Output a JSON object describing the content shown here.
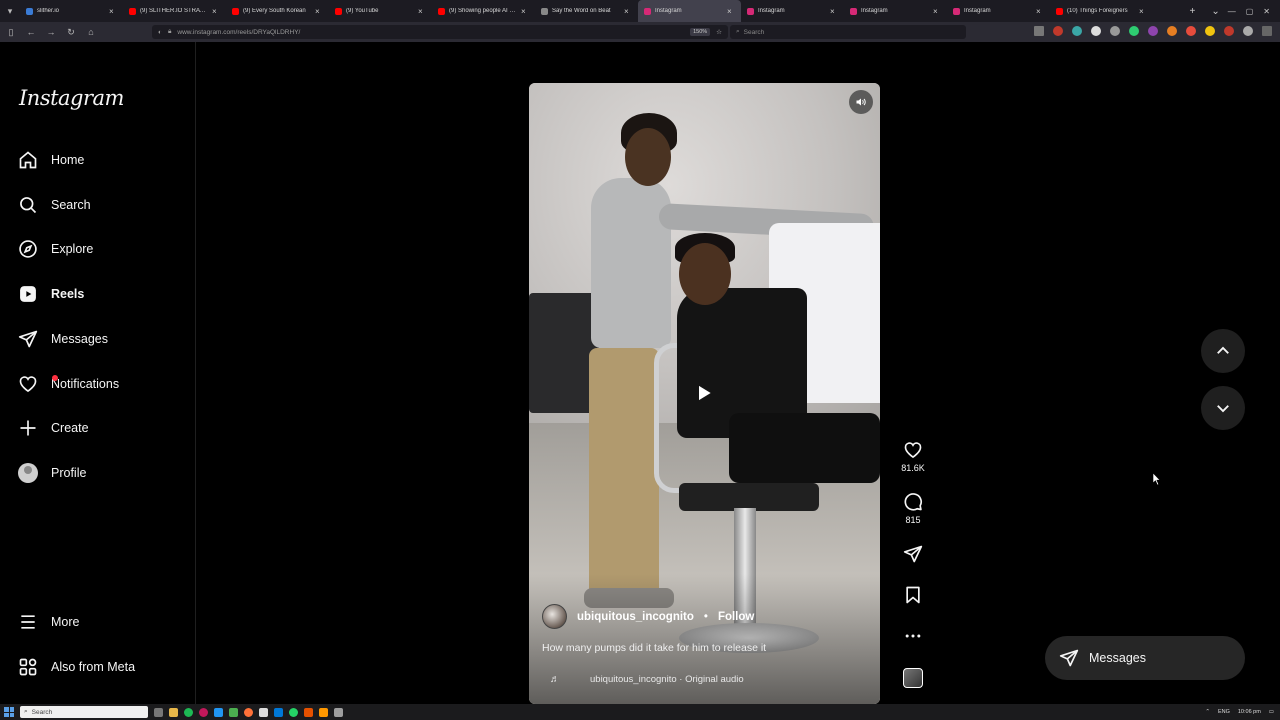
{
  "browser": {
    "tabs": [
      {
        "label": "slither.io",
        "color": "#3a7bd5"
      },
      {
        "label": "(9) SLITHER.IO STRATEGIES",
        "color": "#ff0000"
      },
      {
        "label": "(9) Every South Korean",
        "color": "#ff0000"
      },
      {
        "label": "(9) YouTube",
        "color": "#ff0000"
      },
      {
        "label": "(9) Showing people AI edits",
        "color": "#ff0000"
      },
      {
        "label": "Say the Word on Beat",
        "color": "#888888"
      },
      {
        "label": "Instagram",
        "color": "#d62976",
        "active": true
      },
      {
        "label": "Instagram",
        "color": "#d62976"
      },
      {
        "label": "Instagram",
        "color": "#d62976"
      },
      {
        "label": "Instagram",
        "color": "#d62976"
      },
      {
        "label": "(10) Things Foreigners",
        "color": "#ff0000"
      }
    ],
    "url": "www.instagram.com/reels/DRYaQlLDRHY/",
    "zoom": "150%",
    "search_placeholder": "Search"
  },
  "sidebar": {
    "logo": "Instagram",
    "items": [
      {
        "label": "Home",
        "icon": "home-icon"
      },
      {
        "label": "Search",
        "icon": "search-icon"
      },
      {
        "label": "Explore",
        "icon": "compass-icon"
      },
      {
        "label": "Reels",
        "icon": "reels-icon",
        "active": true
      },
      {
        "label": "Messages",
        "icon": "messages-icon"
      },
      {
        "label": "Notifications",
        "icon": "heart-icon"
      },
      {
        "label": "Create",
        "icon": "plus-icon"
      },
      {
        "label": "Profile",
        "icon": "avatar"
      }
    ],
    "more_label": "More",
    "meta_label": "Also from Meta"
  },
  "reel": {
    "author": "ubiquitous_incognito",
    "separator": "•",
    "follow_label": "Follow",
    "caption": "How many pumps did it take for him to release it",
    "audio": "ubiquitous_incognito · Original audio",
    "likes": "81.6K",
    "comments": "815"
  },
  "messages_pill": {
    "label": "Messages"
  },
  "taskbar": {
    "search_placeholder": "Search",
    "time": "10:06 pm",
    "lang": "ENG"
  },
  "colors": {
    "accent": "#ff3040",
    "page_bg": "#000000",
    "pill_bg": "#262626"
  }
}
